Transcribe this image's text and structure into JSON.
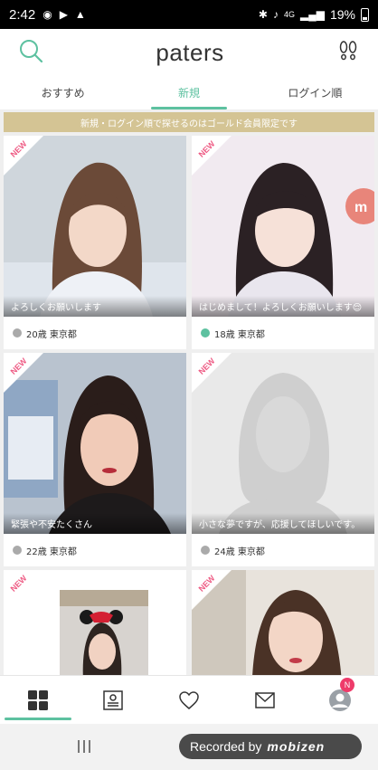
{
  "status": {
    "time": "2:42",
    "network": "4G",
    "battery": "19%"
  },
  "header": {
    "logo": "paters"
  },
  "tabs": [
    {
      "label": "おすすめ",
      "active": false
    },
    {
      "label": "新規",
      "active": true
    },
    {
      "label": "ログイン順",
      "active": false
    }
  ],
  "notice": "新規・ログイン順で探せるのはゴールド会員限定です",
  "cards": [
    {
      "new_label": "NEW",
      "message": "よろしくお願いします",
      "info": "20歳 東京都",
      "online": false
    },
    {
      "new_label": "NEW",
      "message": "はじめまして！よろしくお願いします😌",
      "info": "18歳 東京都",
      "online": true
    },
    {
      "new_label": "NEW",
      "message": "緊張や不安たくさん",
      "info": "22歳 東京都",
      "online": false
    },
    {
      "new_label": "NEW",
      "message": "小さな夢ですが、応援してほしいです。",
      "info": "24歳 東京都",
      "online": false
    },
    {
      "new_label": "NEW",
      "message": "",
      "info": "",
      "online": false
    },
    {
      "new_label": "NEW",
      "message": "",
      "info": "",
      "online": false
    }
  ],
  "bottom_nav": {
    "items": [
      "grid-icon",
      "profile-card-icon",
      "heart-icon",
      "mail-icon",
      "account-icon"
    ],
    "badge": "N"
  },
  "recorder": {
    "text": "Recorded by",
    "brand": "mobizen"
  },
  "colors": {
    "accent": "#5dc1a0",
    "new_pink": "#ee5b84",
    "notice_gold": "#d4c494",
    "badge": "#ee3b6a"
  }
}
